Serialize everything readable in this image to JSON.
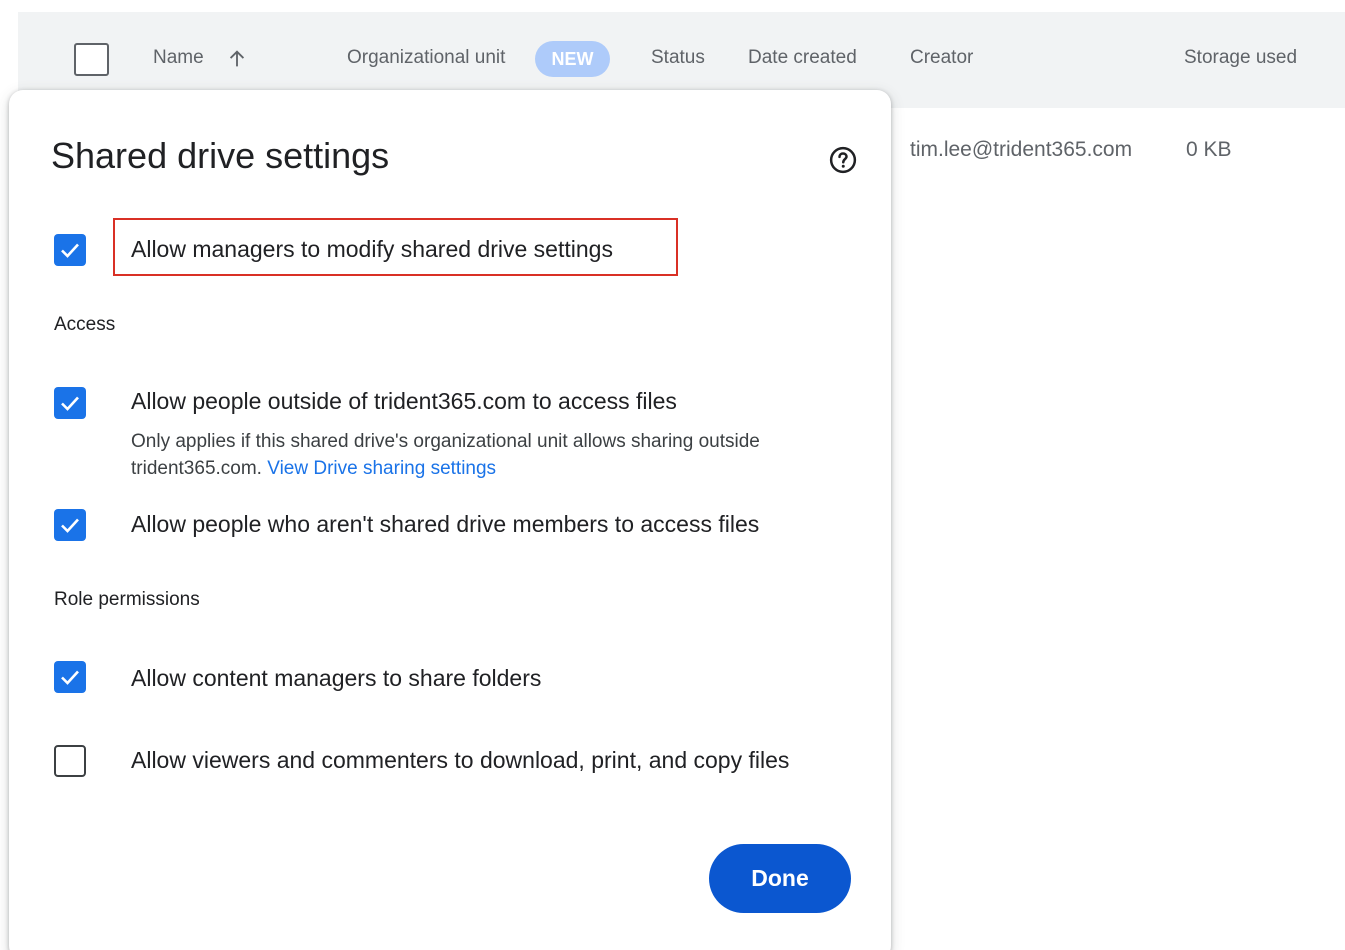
{
  "table": {
    "headers": {
      "name": "Name",
      "org_unit": "Organizational unit",
      "new_badge": "NEW",
      "status": "Status",
      "date_created": "Date created",
      "creator": "Creator",
      "storage_used": "Storage used"
    },
    "row": {
      "creator": "tim.lee@trident365.com",
      "storage": "0 KB"
    }
  },
  "dialog": {
    "title": "Shared drive settings",
    "options": [
      {
        "label": "Allow managers to modify shared drive settings",
        "checked": true
      },
      {
        "label": "Allow people outside of trident365.com to access files",
        "checked": true
      },
      {
        "label": "Allow people who aren't shared drive members to access files",
        "checked": true
      },
      {
        "label": "Allow content managers to share folders",
        "checked": true
      },
      {
        "label": "Allow viewers and commenters to download, print, and copy files",
        "checked": false
      }
    ],
    "sections": {
      "access": "Access",
      "role_permissions": "Role permissions"
    },
    "helper_text": "Only applies if this shared drive's organizational unit allows sharing outside trident365.com.",
    "helper_link": "View Drive sharing settings",
    "done_label": "Done"
  },
  "colors": {
    "accent": "#1a73e8",
    "done_button": "#0b57d0",
    "highlight_border": "#d93025",
    "new_badge": "#aecbfa"
  }
}
